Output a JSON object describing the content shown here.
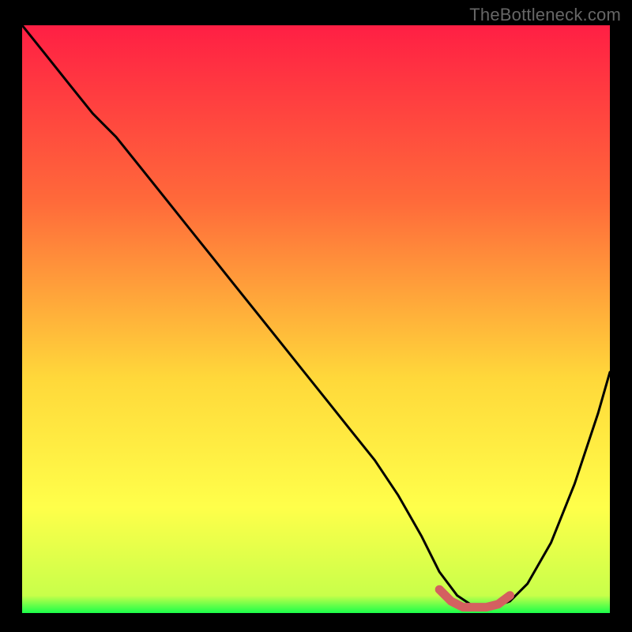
{
  "attribution": "TheBottleneck.com",
  "colors": {
    "gradient_top": "#ff1f44",
    "gradient_mid1": "#ff6a3a",
    "gradient_mid2": "#ffd83a",
    "gradient_mid3": "#ffff4a",
    "gradient_bottom": "#1aff4a",
    "curve": "#000000",
    "highlight": "#d46060",
    "frame": "#000000"
  },
  "chart_data": {
    "type": "line",
    "title": "",
    "xlabel": "",
    "ylabel": "",
    "xlim": [
      0,
      100
    ],
    "ylim": [
      0,
      100
    ],
    "series": [
      {
        "name": "bottleneck-curve",
        "x": [
          0,
          4,
          8,
          12,
          16,
          20,
          24,
          28,
          32,
          36,
          40,
          44,
          48,
          52,
          56,
          60,
          64,
          68,
          71,
          74,
          77,
          80,
          83,
          86,
          90,
          94,
          98,
          100
        ],
        "y": [
          100,
          95,
          90,
          85,
          81,
          76,
          71,
          66,
          61,
          56,
          51,
          46,
          41,
          36,
          31,
          26,
          20,
          13,
          7,
          3,
          1,
          1,
          2,
          5,
          12,
          22,
          34,
          41
        ]
      },
      {
        "name": "optimal-segment",
        "x": [
          71,
          73,
          75,
          77,
          79,
          81,
          83
        ],
        "y": [
          4,
          2,
          1,
          1,
          1,
          1.5,
          3
        ]
      }
    ],
    "gradient_stops": [
      {
        "offset": 0.0,
        "color": "#ff1f44"
      },
      {
        "offset": 0.3,
        "color": "#ff6a3a"
      },
      {
        "offset": 0.6,
        "color": "#ffd83a"
      },
      {
        "offset": 0.82,
        "color": "#ffff4a"
      },
      {
        "offset": 0.97,
        "color": "#c8ff4a"
      },
      {
        "offset": 1.0,
        "color": "#1aff4a"
      }
    ]
  }
}
